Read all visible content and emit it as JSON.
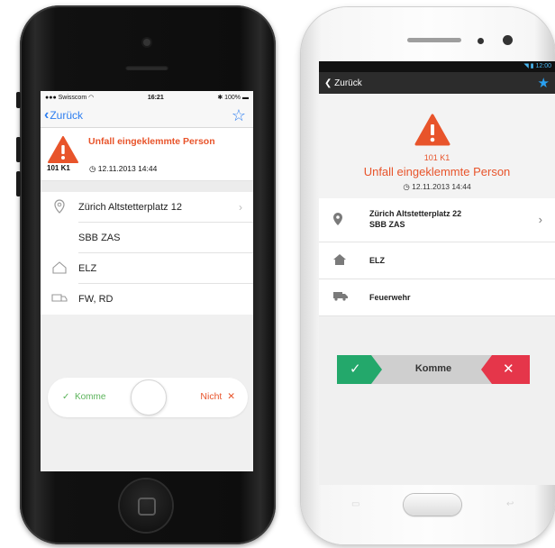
{
  "iphone": {
    "status": {
      "carrier": "Swisscom",
      "time": "16:21",
      "battery": "100%"
    },
    "nav": {
      "back_label": "Zurück",
      "star_icon": "star-outline-icon"
    },
    "alert": {
      "title": "Unfall eingeklemmte Person",
      "code": "101 K1",
      "datetime": "12.11.2013 14:44",
      "accent": "#e8542b"
    },
    "details": {
      "address": "Zürich Altstetterplatz 12",
      "place": "SBB ZAS",
      "station": "ELZ",
      "vehicles": "FW, RD"
    },
    "response": {
      "yes_label": "Komme",
      "no_label": "Nicht"
    }
  },
  "android": {
    "status": {
      "time": "12:00"
    },
    "nav": {
      "back_label": "Zurück",
      "star_icon": "star-filled-icon"
    },
    "alert": {
      "code": "101 K1",
      "title": "Unfall eingeklemmte Person",
      "datetime": "12.11.2013 14:44"
    },
    "details": {
      "address_line1": "Zürich Altstetterplatz 22",
      "address_line2": "SBB ZAS",
      "station": "ELZ",
      "vehicles": "Feuerwehr"
    },
    "response": {
      "label": "Komme",
      "yes_color": "#23a86b",
      "no_color": "#e5364a"
    }
  }
}
